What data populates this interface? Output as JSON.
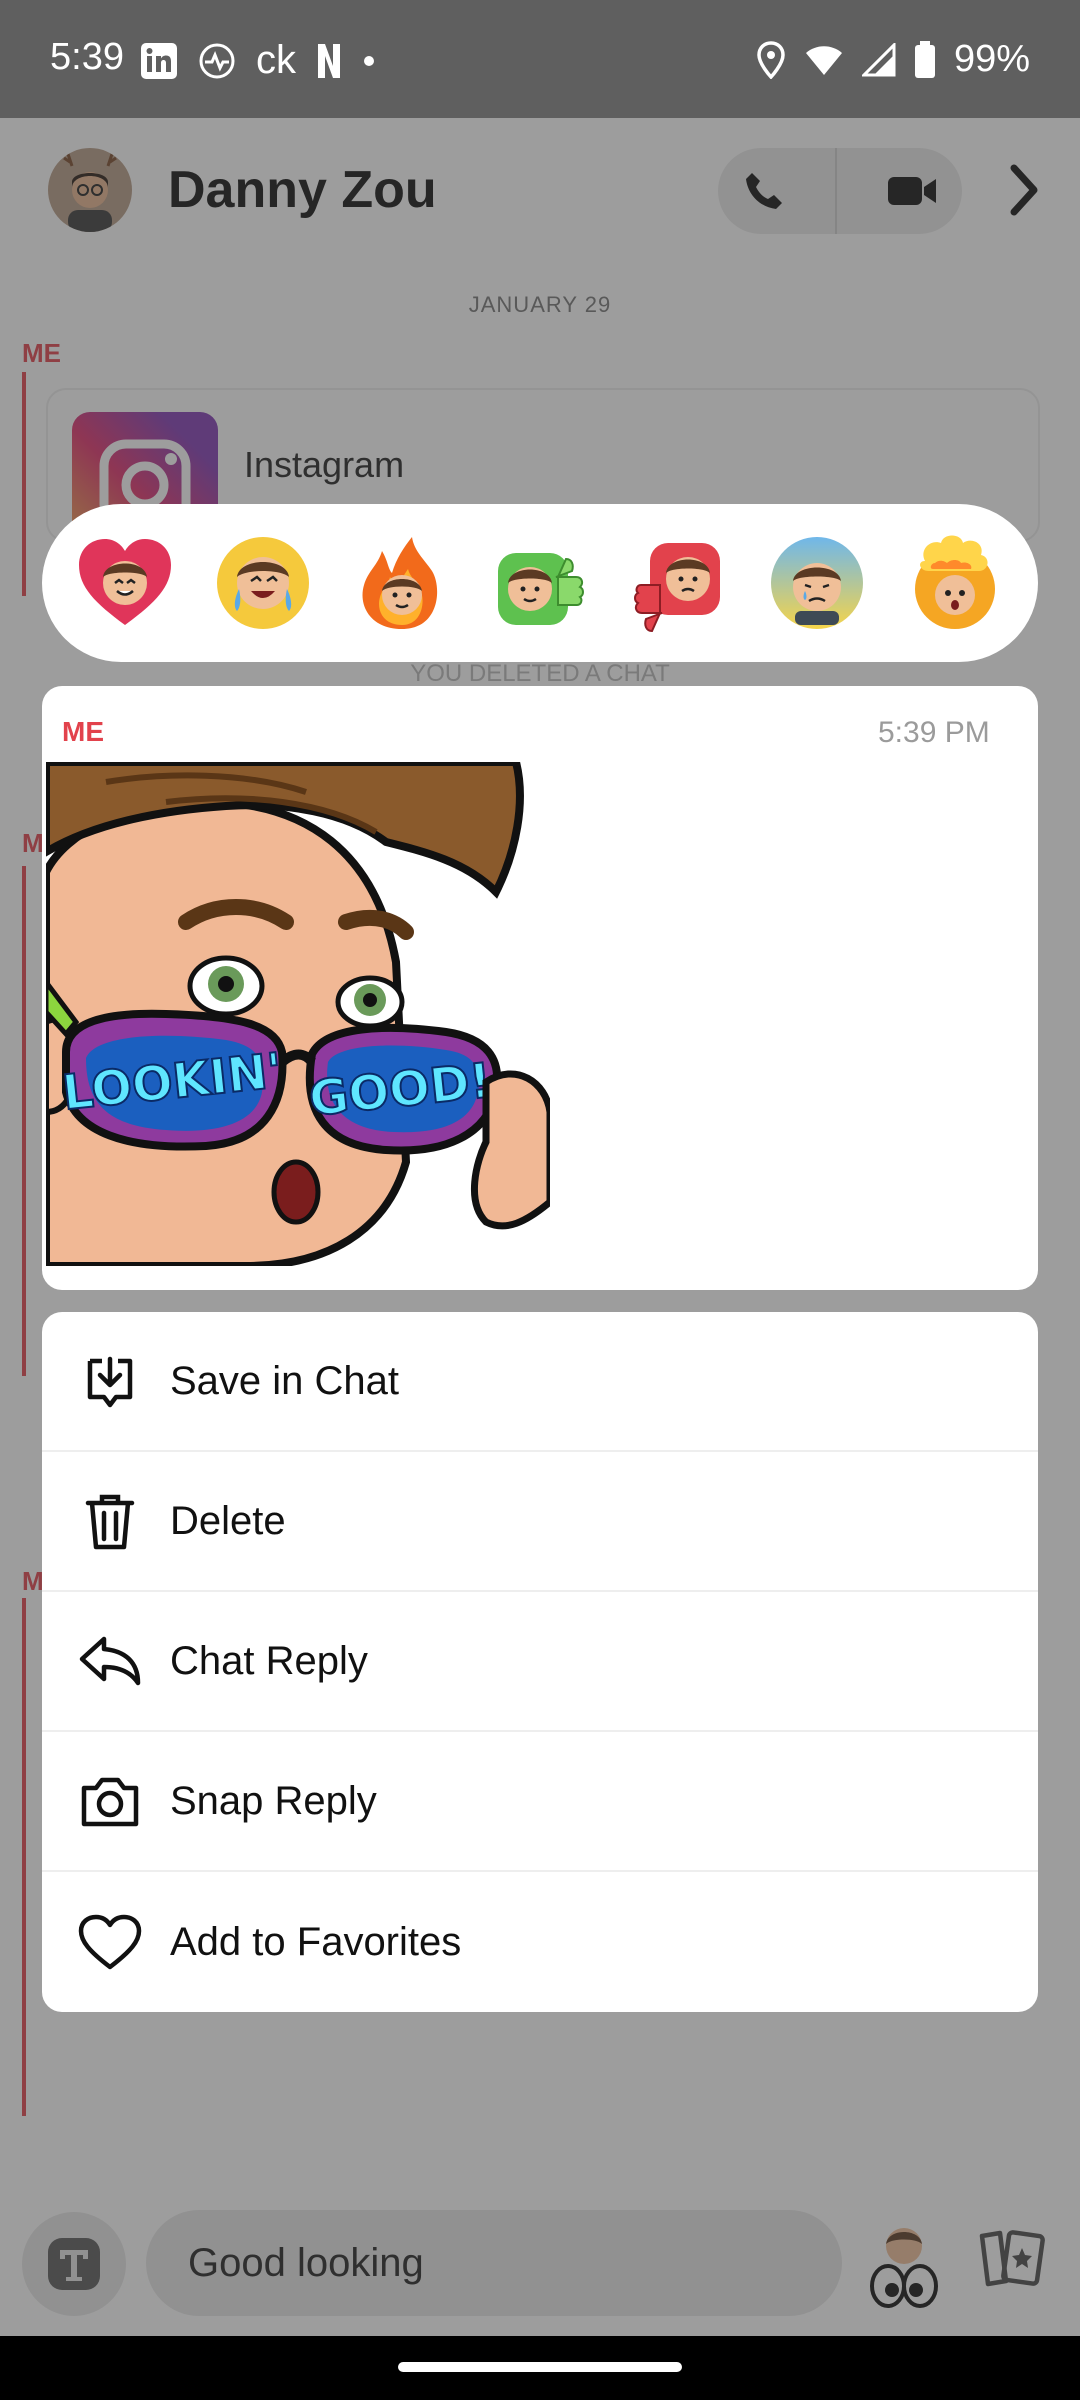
{
  "status_bar": {
    "time": "5:39",
    "battery": "99%",
    "icons": [
      "linkedin-icon",
      "activity-icon",
      "ck-icon",
      "netflix-icon",
      "dot-icon",
      "location-icon",
      "wifi-icon",
      "signal-icon",
      "battery-icon"
    ],
    "ck_text": "ck"
  },
  "header": {
    "contact_name": "Danny Zou"
  },
  "chat": {
    "date_label": "JANUARY 29",
    "me_label": "ME",
    "shared_card_title": "Instagram",
    "deleted_note": "YOU DELETED A CHAT"
  },
  "reactions": [
    "heart-eyes-bitmoji",
    "laughing-tears-bitmoji",
    "fire-bitmoji",
    "thumbs-up-bitmoji",
    "thumbs-down-bitmoji",
    "sad-tear-bitmoji",
    "mind-blown-bitmoji"
  ],
  "message": {
    "sender": "ME",
    "time": "5:39 PM",
    "sticker_text_left": "LOOKIN'",
    "sticker_text_right": "GOOD!"
  },
  "menu": {
    "items": [
      {
        "label": "Save in Chat",
        "icon": "save-icon"
      },
      {
        "label": "Delete",
        "icon": "trash-icon"
      },
      {
        "label": "Chat Reply",
        "icon": "reply-icon"
      },
      {
        "label": "Snap Reply",
        "icon": "camera-icon"
      },
      {
        "label": "Add to Favorites",
        "icon": "heart-icon"
      }
    ]
  },
  "input": {
    "value": "Good looking"
  },
  "colors": {
    "accent_red": "#e2424c",
    "overlay": "#3c3c3c"
  }
}
